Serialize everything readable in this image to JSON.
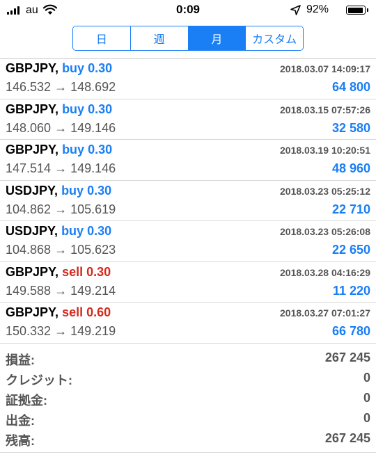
{
  "status_bar": {
    "carrier": "au",
    "time": "0:09",
    "battery_percent": "92%",
    "battery_level": 0.92
  },
  "period_tabs": {
    "tabs": [
      {
        "label": "日",
        "active": false
      },
      {
        "label": "週",
        "active": false
      },
      {
        "label": "月",
        "active": true
      },
      {
        "label": "カスタム",
        "active": false
      }
    ]
  },
  "trades": [
    {
      "symbol": "GBPJPY,",
      "side": "buy",
      "volume": "0.30",
      "datetime": "2018.03.07 14:09:17",
      "open_price": "146.532",
      "arrow": "→",
      "close_price": "148.692",
      "profit": "64 800"
    },
    {
      "symbol": "GBPJPY,",
      "side": "buy",
      "volume": "0.30",
      "datetime": "2018.03.15 07:57:26",
      "open_price": "148.060",
      "arrow": "→",
      "close_price": "149.146",
      "profit": "32 580"
    },
    {
      "symbol": "GBPJPY,",
      "side": "buy",
      "volume": "0.30",
      "datetime": "2018.03.19 10:20:51",
      "open_price": "147.514",
      "arrow": "→",
      "close_price": "149.146",
      "profit": "48 960"
    },
    {
      "symbol": "USDJPY,",
      "side": "buy",
      "volume": "0.30",
      "datetime": "2018.03.23 05:25:12",
      "open_price": "104.862",
      "arrow": "→",
      "close_price": "105.619",
      "profit": "22 710"
    },
    {
      "symbol": "USDJPY,",
      "side": "buy",
      "volume": "0.30",
      "datetime": "2018.03.23 05:26:08",
      "open_price": "104.868",
      "arrow": "→",
      "close_price": "105.623",
      "profit": "22 650"
    },
    {
      "symbol": "GBPJPY,",
      "side": "sell",
      "volume": "0.30",
      "datetime": "2018.03.28 04:16:29",
      "open_price": "149.588",
      "arrow": "→",
      "close_price": "149.214",
      "profit": "11 220"
    },
    {
      "symbol": "GBPJPY,",
      "side": "sell",
      "volume": "0.60",
      "datetime": "2018.03.27 07:01:27",
      "open_price": "150.332",
      "arrow": "→",
      "close_price": "149.219",
      "profit": "66 780"
    }
  ],
  "summary": [
    {
      "label": "損益:",
      "value": "267 245"
    },
    {
      "label": "クレジット:",
      "value": "0"
    },
    {
      "label": "証拠金:",
      "value": "0"
    },
    {
      "label": "出金:",
      "value": "0"
    },
    {
      "label": "残高:",
      "value": "267 245"
    }
  ],
  "colors": {
    "accent_blue": "#1a7ef5",
    "sell_red": "#d6281d",
    "secondary_text": "#555555",
    "divider": "#d8d8d8"
  },
  "icons": {
    "signal": "signal-bars-icon",
    "wifi": "wifi-icon",
    "location": "location-arrow-icon",
    "battery": "battery-icon"
  }
}
